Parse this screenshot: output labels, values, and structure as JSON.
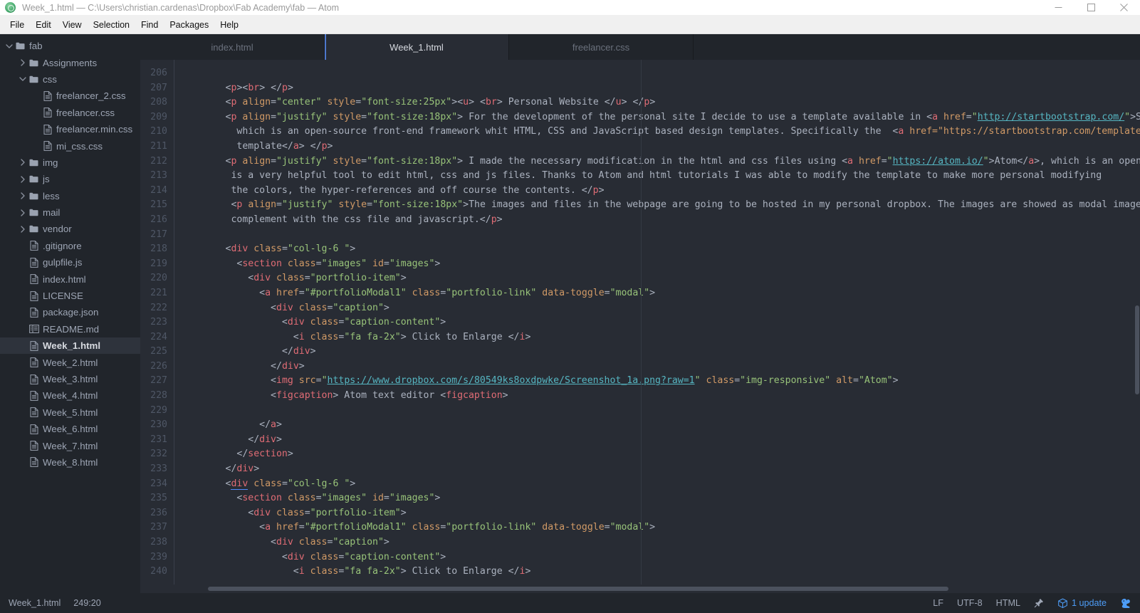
{
  "window": {
    "title": "Week_1.html — C:\\Users\\christian.cardenas\\Dropbox\\Fab Academy\\fab — Atom",
    "logo_icon": "atom-logo-icon",
    "minimize_icon": "minimize-icon",
    "maximize_icon": "maximize-icon",
    "close_icon": "close-icon"
  },
  "menubar": {
    "items": [
      {
        "label": "File"
      },
      {
        "label": "Edit"
      },
      {
        "label": "View"
      },
      {
        "label": "Selection"
      },
      {
        "label": "Find"
      },
      {
        "label": "Packages"
      },
      {
        "label": "Help"
      }
    ]
  },
  "sidebar": {
    "tree": [
      {
        "label": "fab",
        "type": "folder",
        "depth": 0,
        "expanded": true,
        "selected": false
      },
      {
        "label": "Assignments",
        "type": "folder",
        "depth": 1,
        "expanded": false,
        "selected": false
      },
      {
        "label": "css",
        "type": "folder",
        "depth": 1,
        "expanded": true,
        "selected": false
      },
      {
        "label": "freelancer_2.css",
        "type": "file",
        "depth": 2,
        "selected": false
      },
      {
        "label": "freelancer.css",
        "type": "file",
        "depth": 2,
        "selected": false
      },
      {
        "label": "freelancer.min.css",
        "type": "file",
        "depth": 2,
        "selected": false
      },
      {
        "label": "mi_css.css",
        "type": "file",
        "depth": 2,
        "selected": false
      },
      {
        "label": "img",
        "type": "folder",
        "depth": 1,
        "expanded": false,
        "selected": false
      },
      {
        "label": "js",
        "type": "folder",
        "depth": 1,
        "expanded": false,
        "selected": false
      },
      {
        "label": "less",
        "type": "folder",
        "depth": 1,
        "expanded": false,
        "selected": false
      },
      {
        "label": "mail",
        "type": "folder",
        "depth": 1,
        "expanded": false,
        "selected": false
      },
      {
        "label": "vendor",
        "type": "folder",
        "depth": 1,
        "expanded": false,
        "selected": false
      },
      {
        "label": ".gitignore",
        "type": "file",
        "depth": 1,
        "selected": false
      },
      {
        "label": "gulpfile.js",
        "type": "file",
        "depth": 1,
        "selected": false
      },
      {
        "label": "index.html",
        "type": "file",
        "depth": 1,
        "selected": false
      },
      {
        "label": "LICENSE",
        "type": "file",
        "depth": 1,
        "selected": false
      },
      {
        "label": "package.json",
        "type": "file",
        "depth": 1,
        "selected": false
      },
      {
        "label": "README.md",
        "type": "readme",
        "depth": 1,
        "selected": false
      },
      {
        "label": "Week_1.html",
        "type": "file",
        "depth": 1,
        "selected": true
      },
      {
        "label": "Week_2.html",
        "type": "file",
        "depth": 1,
        "selected": false
      },
      {
        "label": "Week_3.html",
        "type": "file",
        "depth": 1,
        "selected": false
      },
      {
        "label": "Week_4.html",
        "type": "file",
        "depth": 1,
        "selected": false
      },
      {
        "label": "Week_5.html",
        "type": "file",
        "depth": 1,
        "selected": false
      },
      {
        "label": "Week_6.html",
        "type": "file",
        "depth": 1,
        "selected": false
      },
      {
        "label": "Week_7.html",
        "type": "file",
        "depth": 1,
        "selected": false
      },
      {
        "label": "Week_8.html",
        "type": "file",
        "depth": 1,
        "selected": false
      }
    ]
  },
  "tabs": [
    {
      "label": "index.html",
      "active": false
    },
    {
      "label": "Week_1.html",
      "active": true
    },
    {
      "label": "freelancer.css",
      "active": false
    }
  ],
  "editor": {
    "first_line": 206,
    "last_line": 240,
    "line_numbers": [
      206,
      207,
      208,
      209,
      210,
      211,
      212,
      213,
      214,
      215,
      216,
      217,
      218,
      219,
      220,
      221,
      222,
      223,
      224,
      225,
      226,
      227,
      228,
      229,
      230,
      231,
      232,
      233,
      234,
      235,
      236,
      237,
      238,
      239,
      240
    ],
    "lines": [
      {
        "n": 206,
        "text": ""
      },
      {
        "n": 207,
        "text": "        <p><br> </p>"
      },
      {
        "n": 208,
        "text": "        <p align=\"center\" style=\"font-size:25px\"><u> <br> Personal Website </u> </p>"
      },
      {
        "n": 209,
        "text": "        <p align=\"justify\" style=\"font-size:18px\"> For the development of the personal site I decide to use a template available in <a href=\"http://startbootstrap.com/\">St"
      },
      {
        "n": 210,
        "text": "          which is an open-source front-end framework whit HTML, CSS and JavaScript based design templates. Specifically the  <a href=\"https://startbootstrap.com/template"
      },
      {
        "n": 211,
        "text": "          template</a> </p>"
      },
      {
        "n": 212,
        "text": "        <p align=\"justify\" style=\"font-size:18px\"> I made the necessary modification in the html and css files using <a href=\"https://atom.io/\">Atom</a>, which is an open"
      },
      {
        "n": 213,
        "text": "         is a very helpful tool to edit html, css and js files. Thanks to Atom and html tutorials I was able to modify the template to make more personal modifying"
      },
      {
        "n": 214,
        "text": "         the colors, the hyper-references and off course the contents. </p>"
      },
      {
        "n": 215,
        "text": "         <p align=\"justify\" style=\"font-size:18px\">The images and files in the webpage are going to be hosted in my personal dropbox. The images are showed as modal images"
      },
      {
        "n": 216,
        "text": "         complement with the css file and javascript.</p>"
      },
      {
        "n": 217,
        "text": ""
      },
      {
        "n": 218,
        "text": "        <div class=\"col-lg-6 \">"
      },
      {
        "n": 219,
        "text": "          <section class=\"images\" id=\"images\">"
      },
      {
        "n": 220,
        "text": "            <div class=\"portfolio-item\">"
      },
      {
        "n": 221,
        "text": "              <a href=\"#portfolioModal1\" class=\"portfolio-link\" data-toggle=\"modal\">"
      },
      {
        "n": 222,
        "text": "                <div class=\"caption\">"
      },
      {
        "n": 223,
        "text": "                  <div class=\"caption-content\">"
      },
      {
        "n": 224,
        "text": "                    <i class=\"fa fa-2x\"> Click to Enlarge </i>"
      },
      {
        "n": 225,
        "text": "                  </div>"
      },
      {
        "n": 226,
        "text": "                </div>"
      },
      {
        "n": 227,
        "text": "                <img src=\"https://www.dropbox.com/s/80549ks8oxdpwke/Screenshot_1a.png?raw=1\" class=\"img-responsive\" alt=\"Atom\">"
      },
      {
        "n": 228,
        "text": "                <figcaption> Atom text editor <figcaption>"
      },
      {
        "n": 229,
        "text": ""
      },
      {
        "n": 230,
        "text": "              </a>"
      },
      {
        "n": 231,
        "text": "            </div>"
      },
      {
        "n": 232,
        "text": "          </section>"
      },
      {
        "n": 233,
        "text": "        </div>"
      },
      {
        "n": 234,
        "text": "        <div class=\"col-lg-6 \">"
      },
      {
        "n": 235,
        "text": "          <section class=\"images\" id=\"images\">"
      },
      {
        "n": 236,
        "text": "            <div class=\"portfolio-item\">"
      },
      {
        "n": 237,
        "text": "              <a href=\"#portfolioModal1\" class=\"portfolio-link\" data-toggle=\"modal\">"
      },
      {
        "n": 238,
        "text": "                <div class=\"caption\">"
      },
      {
        "n": 239,
        "text": "                  <div class=\"caption-content\">"
      },
      {
        "n": 240,
        "text": "                    <i class=\"fa fa-2x\"> Click to Enlarge </i>"
      }
    ]
  },
  "statusbar": {
    "file_name": "Week_1.html",
    "cursor_position": "249:20",
    "line_ending": "LF",
    "encoding": "UTF-8",
    "grammar": "HTML",
    "pin_icon": "pin-icon",
    "updates_icon": "package-cube-icon",
    "updates_label": "1 update",
    "git_icon": "squirrel-icon"
  },
  "colors": {
    "background": "#282c34",
    "sidebar": "#21252b",
    "accent": "#4d9cf6",
    "tab_active_border": "#4d78cc",
    "tag": "#e06c75",
    "attribute": "#d19a66",
    "string": "#98c379",
    "text": "#abb2bf",
    "link": "#56b6c2",
    "line_number": "#4f5766"
  }
}
